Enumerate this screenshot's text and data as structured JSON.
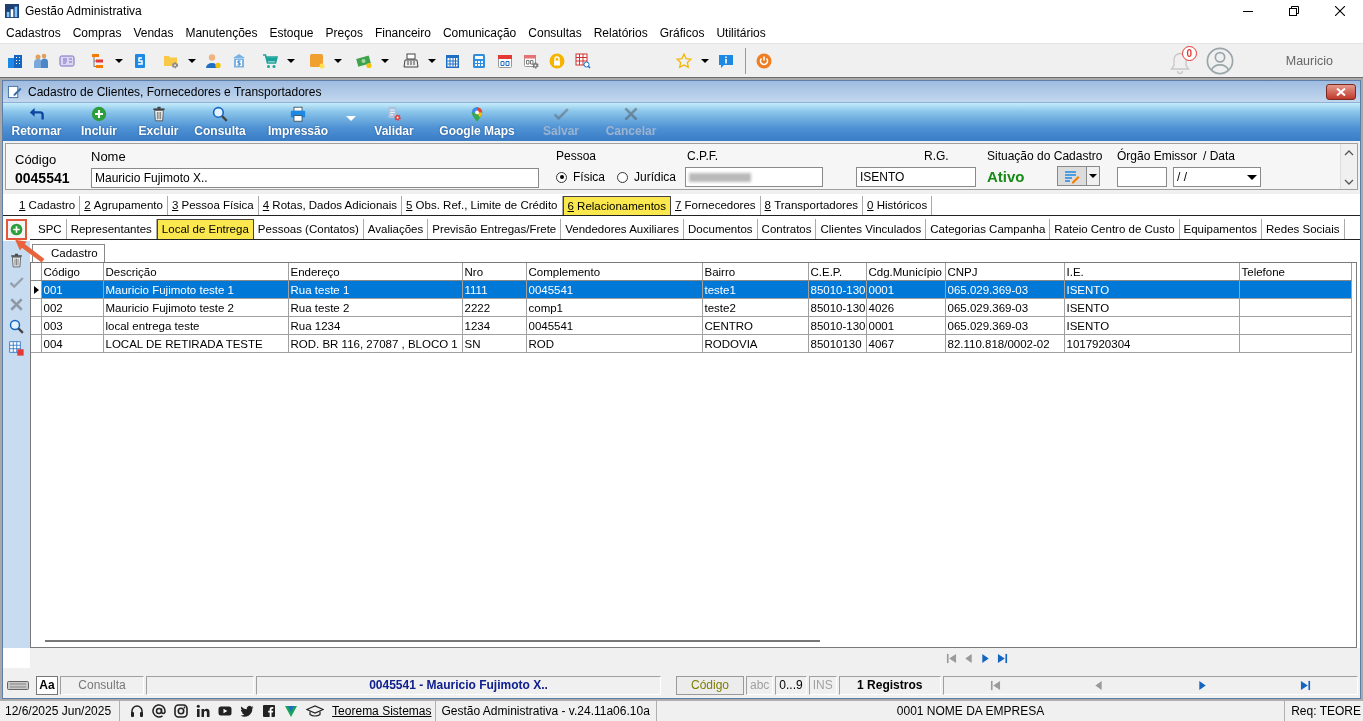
{
  "window": {
    "title": "Gestão Administrativa"
  },
  "menu": [
    "Cadastros",
    "Compras",
    "Vendas",
    "Manutenções",
    "Estoque",
    "Preços",
    "Financeiro",
    "Comunicação",
    "Consultas",
    "Relatórios",
    "Gráficos",
    "Utilitários"
  ],
  "toolbar": {
    "items": [
      {
        "menu": false
      },
      {
        "menu": false
      },
      {
        "menu": false
      },
      {
        "menu": true
      },
      {
        "menu": false
      },
      {
        "menu": true
      },
      {
        "menu": false
      },
      {
        "menu": false
      },
      {
        "menu": true
      },
      {
        "menu": true
      },
      {
        "menu": true
      },
      {
        "menu": true
      },
      {
        "menu": false
      },
      {
        "menu": false
      },
      {
        "menu": false
      },
      {
        "menu": false
      },
      {
        "menu": false
      },
      {
        "menu": false
      },
      {
        "menu": true
      },
      {
        "menu": false
      },
      {
        "menu": false
      }
    ],
    "notifications": "0",
    "user": "Mauricio"
  },
  "form_window": {
    "title": "Cadastro de Clientes, Fornecedores e Transportadores",
    "actions": [
      {
        "label": "Retornar",
        "disabled": false,
        "menu": false
      },
      {
        "label": "Incluir",
        "disabled": false,
        "menu": false
      },
      {
        "label": "Excluir",
        "disabled": false,
        "menu": false
      },
      {
        "label": "Consulta",
        "disabled": false,
        "menu": false
      },
      {
        "label": "Impressão",
        "disabled": false,
        "menu": true
      },
      {
        "label": "Validar",
        "disabled": false,
        "menu": false
      },
      {
        "label": "Google Maps",
        "disabled": false,
        "menu": false
      },
      {
        "label": "Salvar",
        "disabled": true,
        "menu": false
      },
      {
        "label": "Cancelar",
        "disabled": true,
        "menu": false
      }
    ],
    "header": {
      "code_label": "Código",
      "code": "0045541",
      "name_label": "Nome",
      "name": "Mauricio Fujimoto X..",
      "person_label": "Pessoa",
      "person_types": [
        {
          "label": "Física",
          "selected": true
        },
        {
          "label": "Jurídica",
          "selected": false
        }
      ],
      "cpf_label": "C.P.F.",
      "cpf_blurred": true,
      "rg_label": "R.G.",
      "rg": "ISENTO",
      "status_label": "Situação do Cadastro",
      "status": "Ativo",
      "issuer_label": "Órgão Emissor",
      "date_label": "/ Data",
      "date": "/ /"
    },
    "tabs": [
      {
        "key": "1",
        "label": "Cadastro",
        "selected": false
      },
      {
        "key": "2",
        "label": "Agrupamento",
        "selected": false
      },
      {
        "key": "3",
        "label": "Pessoa Física",
        "selected": false
      },
      {
        "key": "4",
        "label": "Rotas, Dados Adicionais",
        "selected": false
      },
      {
        "key": "5",
        "label": "Obs. Ref., Limite de Crédito",
        "selected": false
      },
      {
        "key": "6",
        "label": "Relacionamentos",
        "selected": true
      },
      {
        "key": "7",
        "label": "Fornecedores",
        "selected": false
      },
      {
        "key": "8",
        "label": "Transportadores",
        "selected": false
      },
      {
        "key": "0",
        "label": "Históricos",
        "selected": false
      }
    ],
    "subtabs": [
      {
        "label": "SPC",
        "selected": false
      },
      {
        "label": "Representantes",
        "selected": false
      },
      {
        "label": "Local de Entrega",
        "selected": true
      },
      {
        "label": "Pessoas (Contatos)",
        "selected": false
      },
      {
        "label": "Avaliações",
        "selected": false
      },
      {
        "label": "Previsão Entregas/Frete",
        "selected": false
      },
      {
        "label": "Vendedores Auxiliares",
        "selected": false
      },
      {
        "label": "Documentos",
        "selected": false
      },
      {
        "label": "Contratos",
        "selected": false
      },
      {
        "label": "Clientes Vinculados",
        "selected": false
      },
      {
        "label": "Categorias Campanha",
        "selected": false
      },
      {
        "label": "Rateio Centro de Custo",
        "selected": false
      },
      {
        "label": "Equipamentos",
        "selected": false
      },
      {
        "label": "Redes Sociais",
        "selected": false
      }
    ],
    "page_tab": "Cadastro",
    "side_tools": [
      {
        "disabled": false
      },
      {
        "disabled": true
      },
      {
        "disabled": true
      },
      {
        "disabled": false
      },
      {
        "disabled": false
      }
    ],
    "table": {
      "columns": [
        "Código",
        "Descrição",
        "Endereço",
        "Nro",
        "Complemento",
        "Bairro",
        "C.E.P.",
        "Cdg.Município",
        "CNPJ",
        "I.E.",
        "Telefone"
      ],
      "rows": [
        {
          "selected": true,
          "cells": [
            "001",
            "Mauricio Fujimoto teste 1",
            "Rua teste 1",
            "1111",
            "0045541",
            "teste1",
            "85010-130",
            "0001",
            "065.029.369-03",
            "ISENTO"
          ]
        },
        {
          "selected": false,
          "cells": [
            "002",
            "Mauricio Fujimoto teste 2",
            "Rua teste 2",
            "2222",
            "comp1",
            "teste2",
            "85010-130",
            "4026",
            "065.029.369-03",
            "ISENTO"
          ]
        },
        {
          "selected": false,
          "cells": [
            "003",
            "local entrega teste",
            "Rua 1234",
            "1234",
            "0045541",
            "CENTRO",
            "85010-130",
            "0001",
            "065.029.369-03",
            "ISENTO"
          ]
        },
        {
          "selected": false,
          "cells": [
            "004",
            "LOCAL DE RETIRADA TESTE",
            "ROD. BR 116, 27087 , BLOCO 1",
            "SN",
            "ROD",
            "RODOVIA",
            "85010130",
            "4067",
            "82.110.818/0002-02",
            "1017920304"
          ]
        }
      ]
    },
    "grid_nav": [
      {
        "disabled": true
      },
      {
        "disabled": true
      },
      {
        "disabled": false
      },
      {
        "disabled": false
      }
    ],
    "status": {
      "font_button": "Aa",
      "mode": "Consulta",
      "record": "0045541 - Mauricio Fujimoto X..",
      "order": "Código",
      "modes": [
        {
          "label": "abc",
          "on": false
        },
        {
          "label": "0...9",
          "on": true
        },
        {
          "label": "INS",
          "on": false
        }
      ],
      "count": "1 Registros",
      "nav": [
        {
          "disabled": true
        },
        {
          "disabled": true
        },
        {
          "disabled": false
        },
        {
          "disabled": false
        }
      ]
    }
  },
  "status_bar": {
    "date": "12/6/2025 Jun/2025",
    "link": "Teorema Sistemas",
    "version": "Gestão Administrativa - v.24.11a06.10a",
    "company": "0001 NOME DA EMPRESA",
    "req": "Req: TEORE"
  }
}
